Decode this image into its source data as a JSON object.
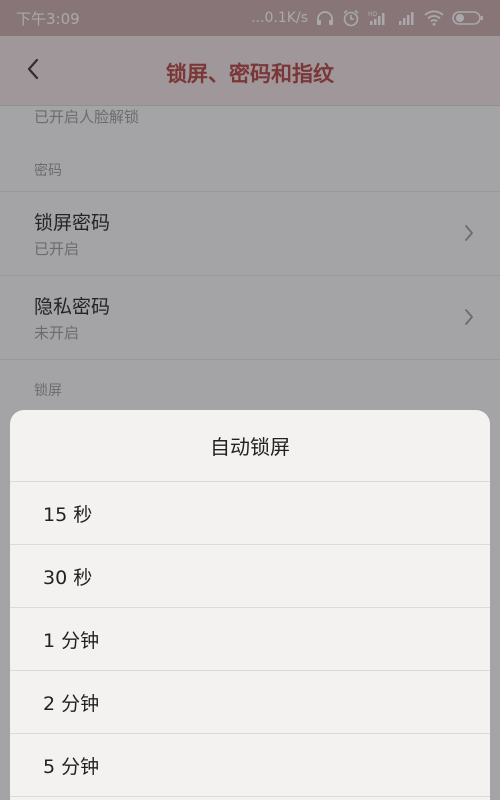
{
  "status_bar": {
    "time": "下午3:09",
    "network_speed": "...0.1K/s",
    "icons": [
      "headphones-icon",
      "alarm-icon",
      "hd-signal-icon",
      "signal-icon",
      "wifi-icon",
      "battery-icon"
    ]
  },
  "header": {
    "title": "锁屏、密码和指纹",
    "back_icon": "back-arrow-icon"
  },
  "settings": {
    "partial_row_sub": "已开启人脸解锁",
    "password_section": "密码",
    "rows": [
      {
        "title": "锁屏密码",
        "sub": "已开启"
      },
      {
        "title": "隐私密码",
        "sub": "未开启"
      }
    ],
    "lock_section": "锁屏"
  },
  "dialog": {
    "title": "自动锁屏",
    "options": [
      "15 秒",
      "30 秒",
      "1 分钟",
      "2 分钟",
      "5 分钟"
    ]
  },
  "colors": {
    "title_accent": "#b34040",
    "sheet_bg": "#f4f1f1",
    "overlay": "rgba(40,40,45,0.40)"
  }
}
